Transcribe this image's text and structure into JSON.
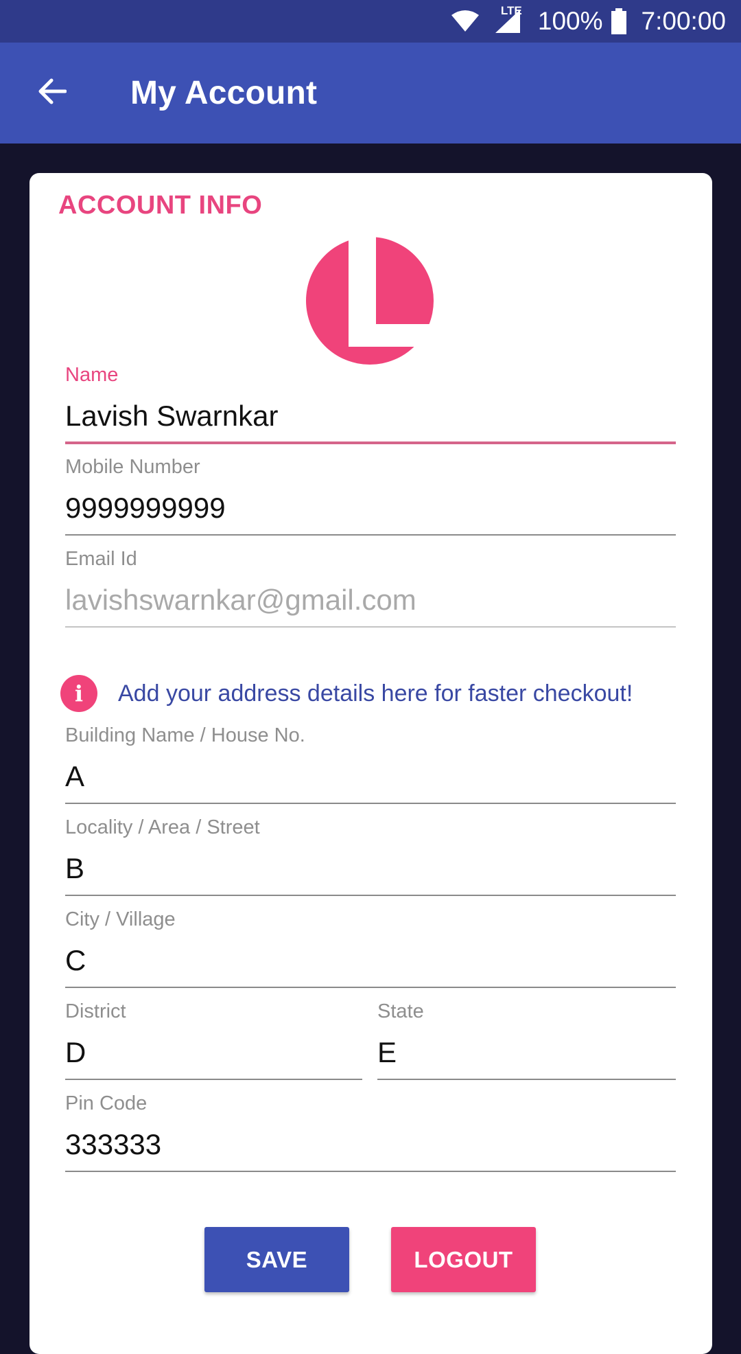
{
  "status_bar": {
    "network": "LTE",
    "battery": "100%",
    "time": "7:00:00",
    "icons": [
      "wifi-icon",
      "signal-icon",
      "battery-icon"
    ]
  },
  "app_bar": {
    "back_icon": "arrow-back-icon",
    "title": "My Account"
  },
  "account": {
    "section_title": "ACCOUNT INFO",
    "fields": {
      "name": {
        "label": "Name",
        "value": "Lavish Swarnkar"
      },
      "mobile": {
        "label": "Mobile Number",
        "value": "9999999999"
      },
      "email": {
        "label": "Email Id",
        "value": "lavishswarnkar@gmail.com"
      }
    }
  },
  "address": {
    "info_icon": "info-icon",
    "info_text": "Add your address details here for faster checkout!",
    "fields": {
      "building": {
        "label": "Building Name / House No.",
        "value": "A"
      },
      "locality": {
        "label": "Locality / Area / Street",
        "value": "B"
      },
      "city": {
        "label": "City / Village",
        "value": "C"
      },
      "district": {
        "label": "District",
        "value": "D"
      },
      "state": {
        "label": "State",
        "value": "E"
      },
      "pincode": {
        "label": "Pin Code",
        "value": "333333"
      }
    }
  },
  "actions": {
    "save": "SAVE",
    "logout": "LOGOUT"
  },
  "colors": {
    "primary": "#3d51b4",
    "accent": "#f0437a",
    "background": "#14132b"
  }
}
